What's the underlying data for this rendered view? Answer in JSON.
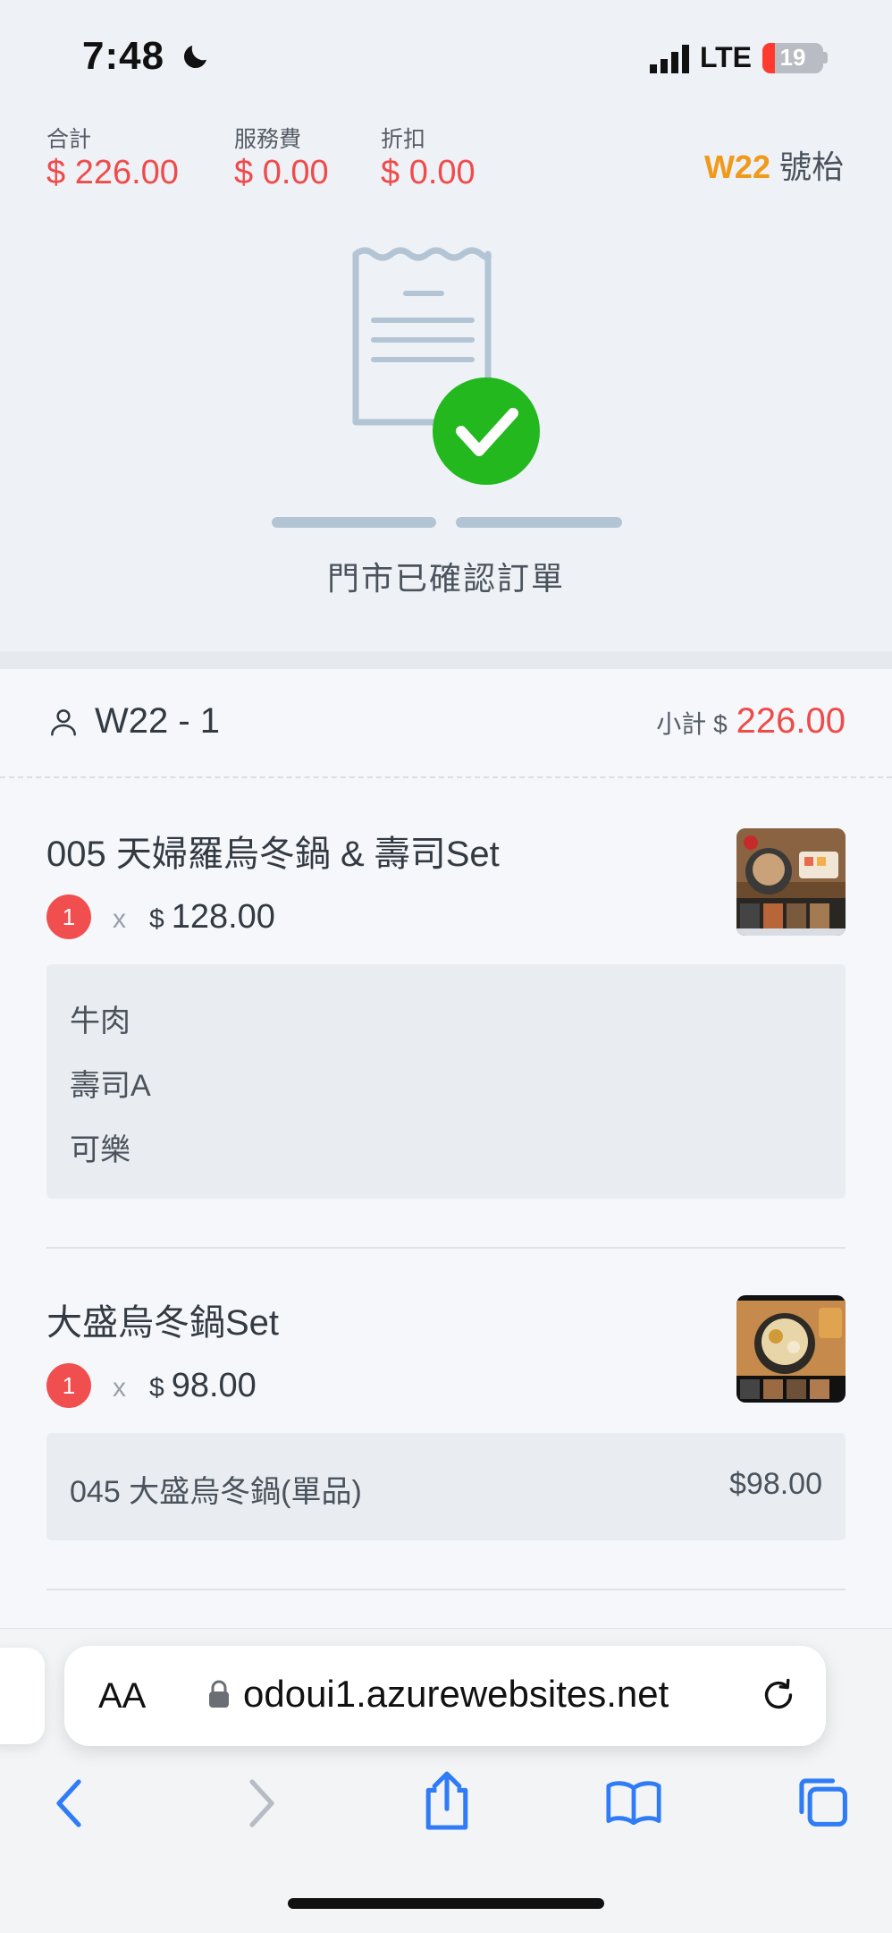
{
  "status_bar": {
    "time": "7:48",
    "network": "LTE",
    "battery": "19"
  },
  "summary": {
    "total_label": "合計",
    "total_value": "$ 226.00",
    "service_label": "服務費",
    "service_value": "$ 0.00",
    "discount_label": "折扣",
    "discount_value": "$ 0.00",
    "table_code": "W22",
    "table_suffix": "號枱"
  },
  "confirmation": {
    "text": "門市已確認訂單"
  },
  "order": {
    "seat": "W22 - 1",
    "subtotal_label": "小計 $",
    "subtotal_value": "226.00",
    "items": [
      {
        "name": "005 天婦羅烏冬鍋 & 壽司Set",
        "qty": "1",
        "times": "x",
        "currency": "$",
        "price": "128.00",
        "options": [
          "牛肉",
          "壽司A",
          "可樂"
        ]
      },
      {
        "name": "大盛烏冬鍋Set",
        "qty": "1",
        "times": "x",
        "currency": "$",
        "price": "98.00",
        "sub_name": "045 大盛烏冬鍋(單品)",
        "sub_price": "$98.00"
      }
    ]
  },
  "browser": {
    "aa_label": "AA",
    "url": "odoui1.azurewebsites.net"
  },
  "colors": {
    "accent_red": "#ef4b4b",
    "table_orange": "#ef9a1b",
    "success_green": "#22b81e",
    "ios_blue": "#2f7cf6"
  }
}
